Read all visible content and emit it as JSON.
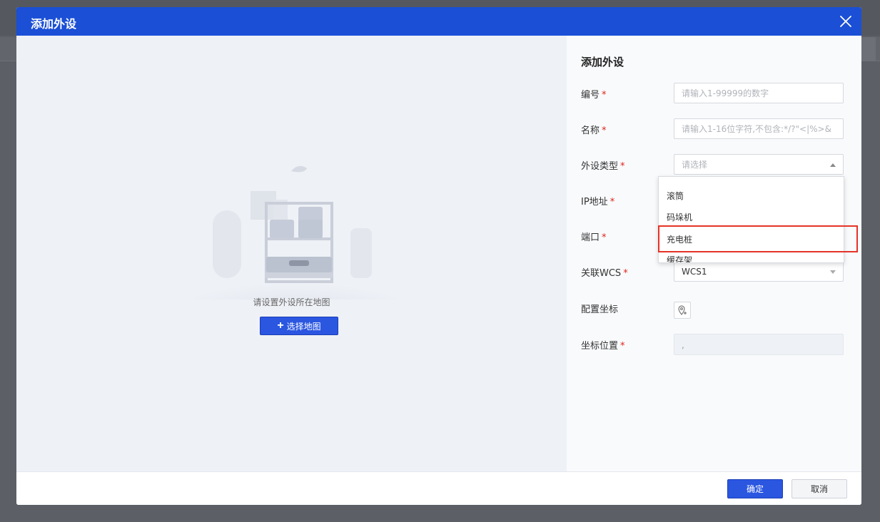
{
  "modal": {
    "title": "添加外设",
    "close_icon": "close-icon"
  },
  "map_panel": {
    "hint": "请设置外设所在地图",
    "select_map_label": "选择地图",
    "select_map_icon": "plus-icon",
    "illustration": "warehouse-shelf-illustration"
  },
  "form": {
    "title": "添加外设",
    "fields": {
      "number": {
        "label": "编号",
        "required": "*",
        "placeholder": "请输入1-99999的数字"
      },
      "name": {
        "label": "名称",
        "required": "*",
        "placeholder": "请输入1-16位字符,不包含:*/?\"<|%>&"
      },
      "type": {
        "label": "外设类型",
        "required": "*",
        "placeholder": "请选择"
      },
      "ip": {
        "label": "IP地址",
        "required": "*"
      },
      "port": {
        "label": "端口",
        "required": "*"
      },
      "wcs": {
        "label": "关联WCS",
        "required": "*",
        "value": "WCS1"
      },
      "config_coord": {
        "label": "配置坐标",
        "icon": "map-pin-add-icon"
      },
      "coord_pos": {
        "label": "坐标位置",
        "required": "*",
        "value": ","
      }
    }
  },
  "dropdown": {
    "options": [
      "滚筒",
      "码垛机",
      "充电桩",
      "缓存架"
    ],
    "highlighted": "充电桩"
  },
  "footer": {
    "ok_label": "确定",
    "cancel_label": "取消"
  },
  "colors": {
    "primary": "#1a4fd6",
    "button": "#2a56e0",
    "required": "#e2231a",
    "highlight_box": "#e53327"
  }
}
